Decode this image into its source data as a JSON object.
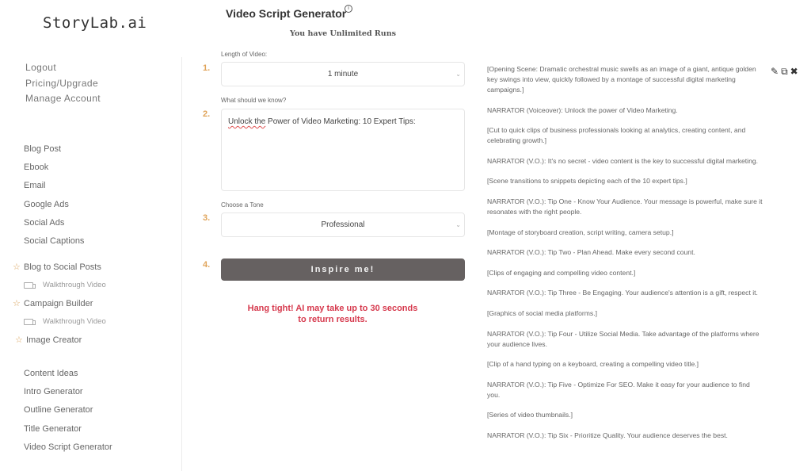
{
  "brand": {
    "logo": "StoryLab.ai"
  },
  "account_links": [
    "Logout",
    "Pricing/Upgrade",
    "Manage Account"
  ],
  "nav_primary": [
    "Blog Post",
    "Ebook",
    "Email",
    "Google Ads",
    "Social Ads",
    "Social Captions"
  ],
  "favorites": [
    {
      "label": "Blog to Social Posts",
      "icon": "star-icon",
      "sub": {
        "label": "Walkthrough Video",
        "icon": "video-camera-icon"
      }
    },
    {
      "label": "Campaign Builder",
      "icon": "star-icon",
      "sub": {
        "label": "Walkthrough Video",
        "icon": "video-camera-icon"
      }
    },
    {
      "label": "Image Creator",
      "icon": "star-icon"
    }
  ],
  "nav_secondary": [
    "Content Ideas",
    "Intro Generator",
    "Outline Generator",
    "Title Generator",
    "Video Script Generator"
  ],
  "main": {
    "title": "Video Script Generator",
    "info_icon": "ⓘ",
    "runs_text": "You have Unlimited Runs",
    "steps": [
      "1.",
      "2.",
      "3.",
      "4."
    ],
    "length": {
      "label": "Length of Video:",
      "value": "1 minute"
    },
    "know": {
      "label": "What should we know?",
      "value_underlined": "Unlock the",
      "value_rest": " Power of Video Marketing: 10 Expert Tips:"
    },
    "tone": {
      "label": "Choose a Tone",
      "value": "Professional"
    },
    "submit_label": "Inspire me!",
    "wait_line1": "Hang tight! AI may take up to 30 seconds",
    "wait_line2": "to return results."
  },
  "output": {
    "tools": {
      "edit": "✎",
      "copy": "⧉",
      "close": "✖"
    },
    "paragraphs": [
      "[Opening Scene: Dramatic orchestral music swells as an image of a giant, antique golden key swings into view, quickly followed by a montage of successful digital marketing campaigns.]",
      "NARRATOR (Voiceover): Unlock the power of Video Marketing.",
      "[Cut to quick clips of business professionals looking at analytics, creating content, and celebrating growth.]",
      "NARRATOR (V.O.): It's no secret - video content is the key to successful digital marketing.",
      "[Scene transitions to snippets depicting each of the 10 expert tips.]",
      "NARRATOR (V.O.): Tip One - Know Your Audience. Your message is powerful, make sure it resonates with the right people.",
      "[Montage of storyboard creation, script writing, camera setup.]",
      "NARRATOR (V.O.): Tip Two - Plan Ahead. Make every second count.",
      "[Clips of engaging and compelling video content.]",
      "NARRATOR (V.O.): Tip Three - Be Engaging. Your audience's attention is a gift, respect it.",
      "[Graphics of social media platforms.]",
      "NARRATOR (V.O.): Tip Four - Utilize Social Media. Take advantage of the platforms where your audience lives.",
      "[Clip of a hand typing on a keyboard, creating a compelling video title.]",
      "NARRATOR (V.O.): Tip Five - Optimize For SEO. Make it easy for your audience to find you.",
      "[Series of video thumbnails.]",
      "NARRATOR (V.O.): Tip Six - Prioritize Quality. Your audience deserves the best."
    ]
  }
}
